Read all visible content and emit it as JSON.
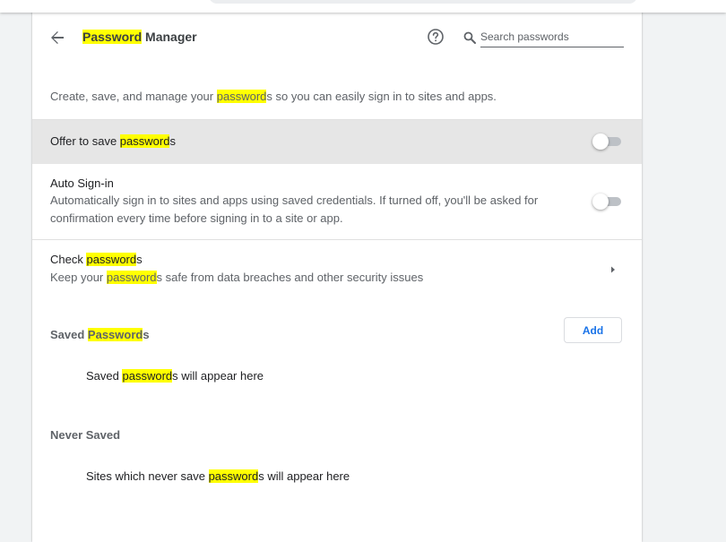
{
  "header": {
    "title_highlight": "Password",
    "title_rest": " Manager",
    "search_placeholder": "Search passwords"
  },
  "description": {
    "before": "Create, save, and manage your ",
    "highlight": "password",
    "after": "s so you can easily sign in to sites and apps."
  },
  "settings": {
    "offer_save": {
      "label_before": "Offer to save ",
      "label_highlight": "password",
      "label_after": "s",
      "enabled": false
    },
    "auto_signin": {
      "label": "Auto Sign-in",
      "sub": "Automatically sign in to sites and apps using saved credentials. If turned off, you'll be asked for confirmation every time before signing in to a site or app.",
      "enabled": false
    },
    "check_passwords": {
      "label_before": "Check ",
      "label_highlight": "password",
      "label_after": "s",
      "sub_before": "Keep your ",
      "sub_highlight": "password",
      "sub_after": "s safe from data breaches and other security issues"
    }
  },
  "saved_passwords": {
    "title_before": "Saved ",
    "title_highlight": "Password",
    "title_after": "s",
    "add_label": "Add",
    "empty_before": "Saved ",
    "empty_highlight": "password",
    "empty_after": "s will appear here"
  },
  "never_saved": {
    "title": "Never Saved",
    "empty_before": "Sites which never save ",
    "empty_highlight": "password",
    "empty_after": "s will appear here"
  },
  "colors": {
    "highlight": "#ffff00",
    "accent": "#1a73e8",
    "hover_row": "#e6e6e6"
  },
  "icons": {
    "back": "arrow-back-icon",
    "help": "help-circle-icon",
    "search": "search-icon",
    "arrow": "chevron-right-icon"
  }
}
